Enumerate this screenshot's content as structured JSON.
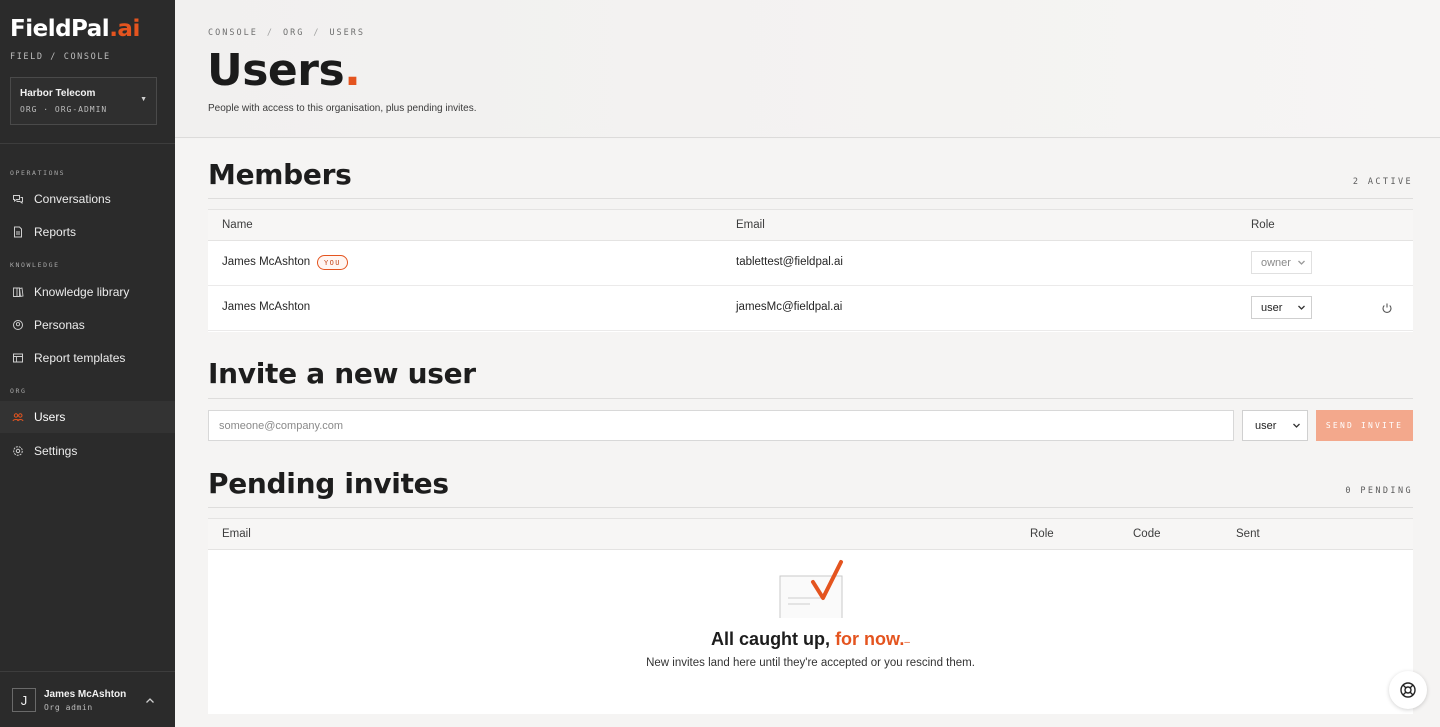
{
  "brand": {
    "name": "FieldPal",
    "suffix": ".ai",
    "subtitle": "FIELD / CONSOLE",
    "accent": "#e4541f"
  },
  "org_switcher": {
    "name": "Harbor Telecom",
    "meta": "ORG · ORG-ADMIN"
  },
  "sidebar": {
    "sections": [
      {
        "label": "OPERATIONS"
      },
      {
        "label": "KNOWLEDGE"
      },
      {
        "label": "ORG"
      }
    ],
    "items": [
      {
        "label": "Conversations",
        "icon": "chat-icon"
      },
      {
        "label": "Reports",
        "icon": "document-icon"
      },
      {
        "label": "Knowledge library",
        "icon": "book-icon"
      },
      {
        "label": "Personas",
        "icon": "persona-icon"
      },
      {
        "label": "Report templates",
        "icon": "template-icon"
      },
      {
        "label": "Users",
        "icon": "users-icon",
        "active": true
      },
      {
        "label": "Settings",
        "icon": "gear-icon"
      }
    ]
  },
  "current_user": {
    "initial": "J",
    "name": "James McAshton",
    "role": "Org admin"
  },
  "breadcrumb": [
    "CONSOLE",
    "ORG",
    "USERS"
  ],
  "page": {
    "title": "Users",
    "title_dot": ".",
    "subtitle": "People with access to this organisation, plus pending invites."
  },
  "members": {
    "title": "Members",
    "count": "2 ACTIVE",
    "columns": {
      "name": "Name",
      "email": "Email",
      "role": "Role"
    },
    "rows": [
      {
        "name": "James McAshton",
        "badge": "YOU",
        "email": "tablettest@fieldpal.ai",
        "role": "owner"
      },
      {
        "name": "James McAshton",
        "email": "jamesMc@fieldpal.ai",
        "role": "user"
      }
    ]
  },
  "invite": {
    "title": "Invite a new user",
    "placeholder": "someone@company.com",
    "role": "user",
    "button": "SEND INVITE"
  },
  "pending": {
    "title": "Pending invites",
    "count": "0 PENDING",
    "columns": {
      "email": "Email",
      "role": "Role",
      "code": "Code",
      "sent": "Sent"
    },
    "empty": {
      "title_main": "All caught up,",
      "title_accent": "for now.",
      "title_dash": "–",
      "subtitle": "New invites land here until they're accepted or you rescind them."
    }
  }
}
